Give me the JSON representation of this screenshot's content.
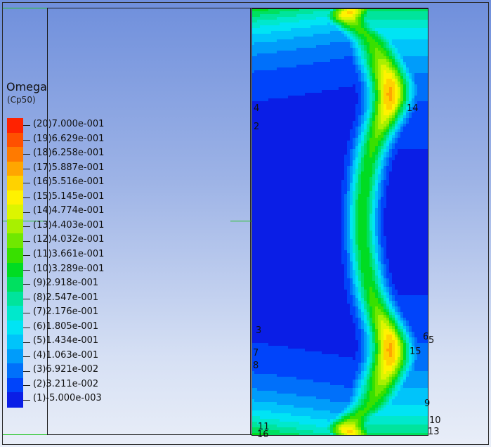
{
  "legend": {
    "title": "Omega",
    "subtitle": "(Cp50)"
  },
  "chart_data": {
    "type": "heatmap",
    "variable": "Omega",
    "units": "(Cp50)",
    "levels": [
      {
        "index": 20,
        "value": 0.7,
        "label": "(20)7.000e-001",
        "color": "#ff2200"
      },
      {
        "index": 19,
        "value": 0.6629,
        "label": "(19)6.629e-001",
        "color": "#ff5000"
      },
      {
        "index": 18,
        "value": 0.6258,
        "label": "(18)6.258e-001",
        "color": "#ff7a00"
      },
      {
        "index": 17,
        "value": 0.5887,
        "label": "(17)5.887e-001",
        "color": "#ffa600"
      },
      {
        "index": 16,
        "value": 0.5516,
        "label": "(16)5.516e-001",
        "color": "#ffd200"
      },
      {
        "index": 15,
        "value": 0.5145,
        "label": "(15)5.145e-001",
        "color": "#fff200"
      },
      {
        "index": 14,
        "value": 0.4774,
        "label": "(14)4.774e-001",
        "color": "#dcf500"
      },
      {
        "index": 13,
        "value": 0.4403,
        "label": "(13)4.403e-001",
        "color": "#a8f000"
      },
      {
        "index": 12,
        "value": 0.4032,
        "label": "(12)4.032e-001",
        "color": "#70e800"
      },
      {
        "index": 11,
        "value": 0.3661,
        "label": "(11)3.661e-001",
        "color": "#38e000"
      },
      {
        "index": 10,
        "value": 0.3289,
        "label": "(10)3.289e-001",
        "color": "#00dc22"
      },
      {
        "index": 9,
        "value": 0.2918,
        "label": "(9)2.918e-001",
        "color": "#00e060"
      },
      {
        "index": 8,
        "value": 0.2547,
        "label": "(8)2.547e-001",
        "color": "#00e49c"
      },
      {
        "index": 7,
        "value": 0.2176,
        "label": "(7)2.176e-001",
        "color": "#00e8cc"
      },
      {
        "index": 6,
        "value": 0.1805,
        "label": "(6)1.805e-001",
        "color": "#00e4f4"
      },
      {
        "index": 5,
        "value": 0.1434,
        "label": "(5)1.434e-001",
        "color": "#00c4fa"
      },
      {
        "index": 4,
        "value": 0.1063,
        "label": "(4)1.063e-001",
        "color": "#009cfa"
      },
      {
        "index": 3,
        "value": 0.06921,
        "label": "(3)6.921e-002",
        "color": "#0070fa"
      },
      {
        "index": 2,
        "value": 0.03211,
        "label": "(2)3.211e-002",
        "color": "#0044fa"
      },
      {
        "index": 1,
        "value": -0.005,
        "label": "(1)-5.000e-003",
        "color": "#0a1ee6"
      }
    ],
    "contour_labels": [
      "4",
      "2",
      "14",
      "3",
      "7",
      "8",
      "6",
      "5",
      "15",
      "9",
      "10",
      "13",
      "11",
      "16"
    ]
  }
}
